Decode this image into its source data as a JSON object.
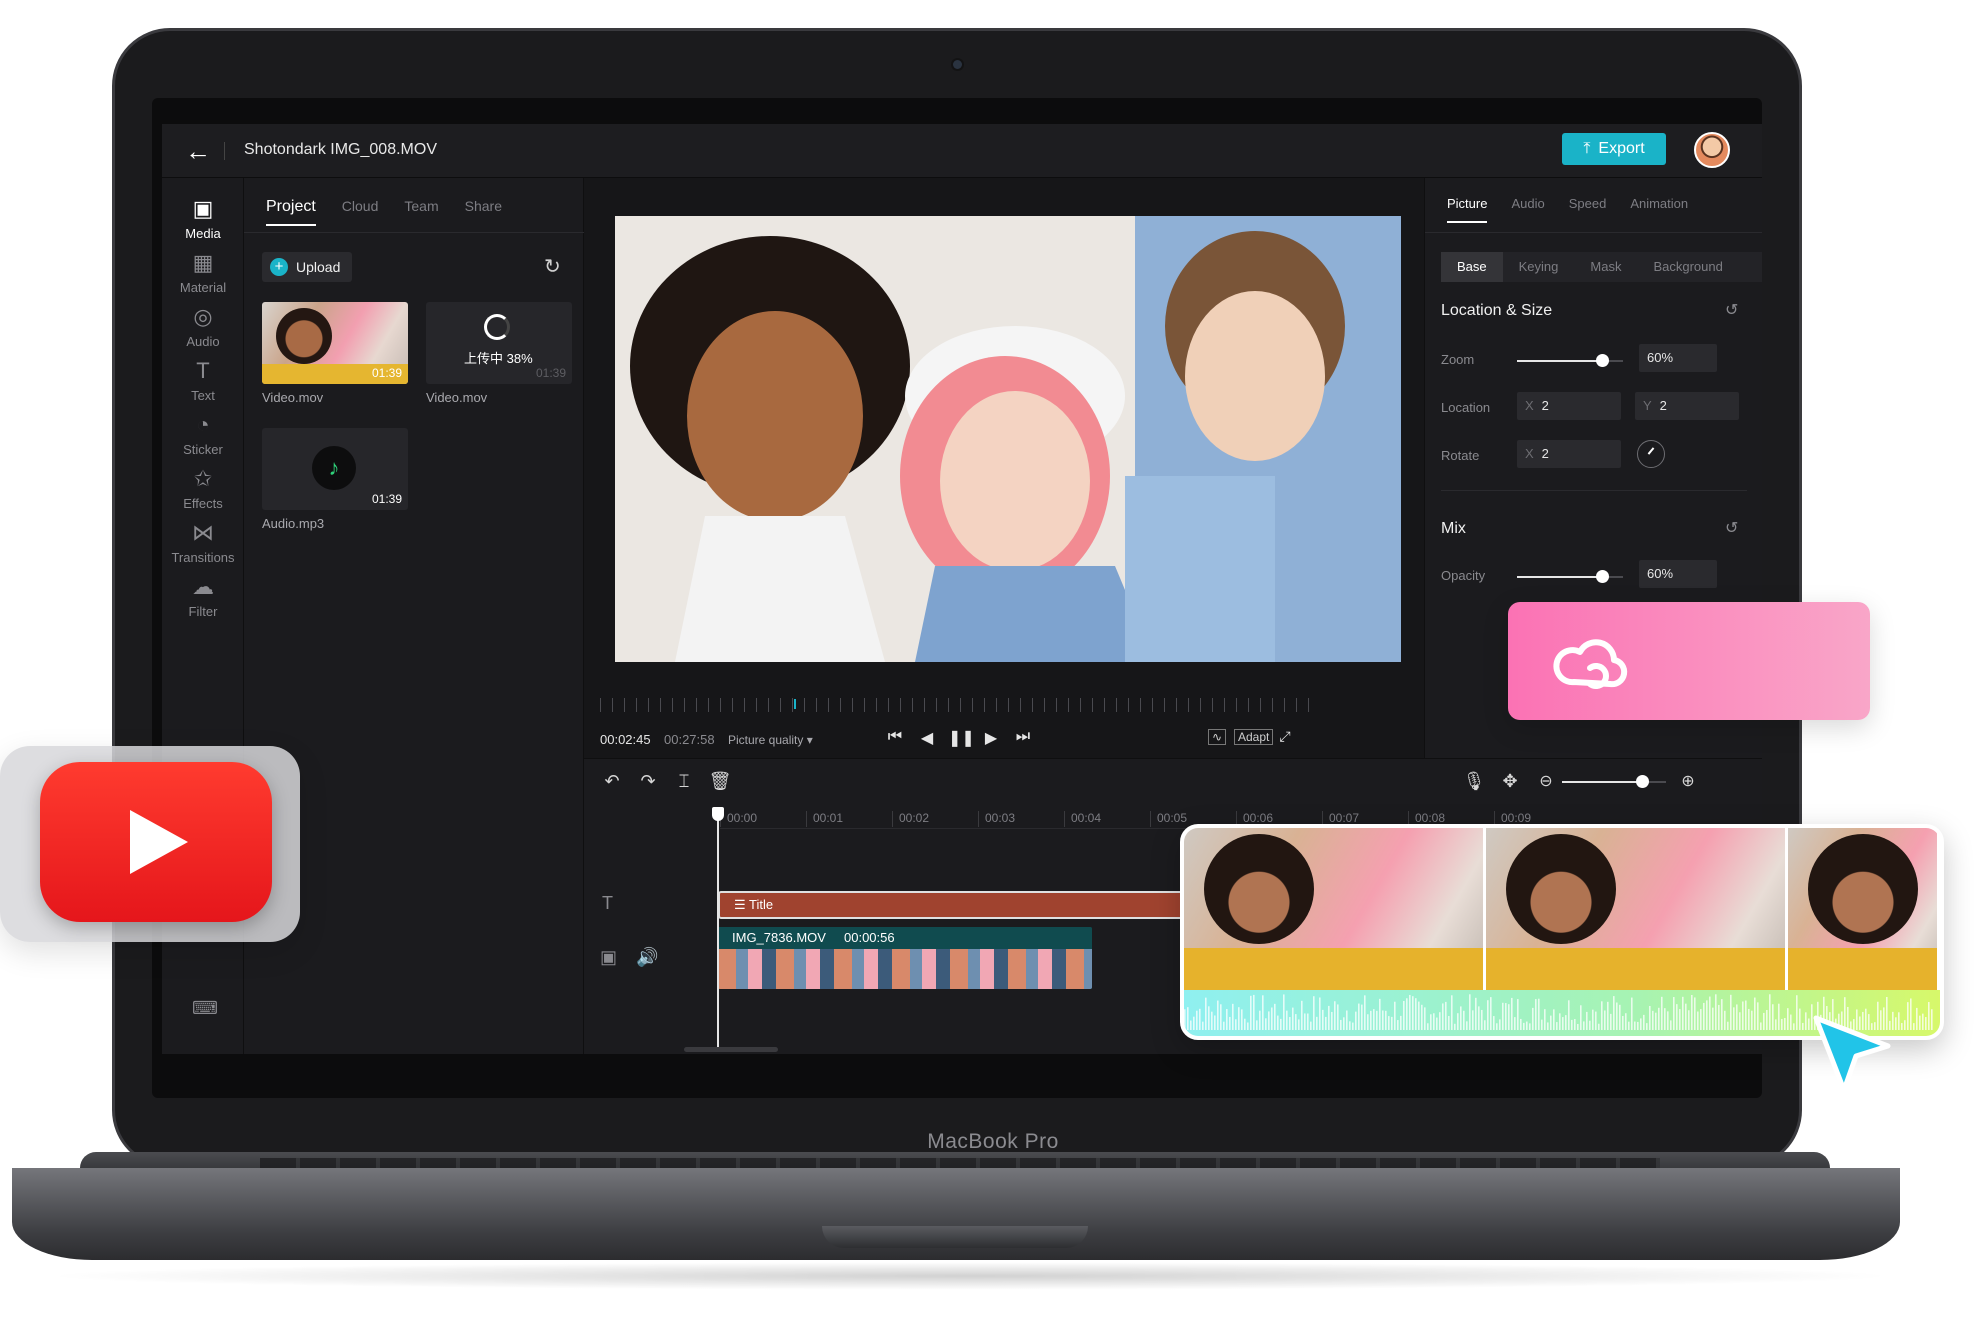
{
  "window": {
    "title": "Shotondark IMG_008.MOV"
  },
  "header": {
    "export_label": "Export"
  },
  "rail": {
    "items": [
      {
        "label": "Media",
        "icon": "media-icon"
      },
      {
        "label": "Material",
        "icon": "material-icon"
      },
      {
        "label": "Audio",
        "icon": "audio-icon"
      },
      {
        "label": "Text",
        "icon": "text-icon"
      },
      {
        "label": "Sticker",
        "icon": "sticker-icon"
      },
      {
        "label": "Effects",
        "icon": "effects-icon"
      },
      {
        "label": "Transitions",
        "icon": "transitions-icon"
      },
      {
        "label": "Filter",
        "icon": "filter-icon"
      }
    ]
  },
  "media": {
    "tabs": [
      "Project",
      "Cloud",
      "Team",
      "Share"
    ],
    "upload_label": "Upload",
    "items": [
      {
        "name": "Video.mov",
        "duration": "01:39"
      },
      {
        "name": "Video.mov",
        "duration": "01:39",
        "status": "上传中 38%",
        "progress": 0.38
      },
      {
        "name": "Audio.mp3",
        "duration": "01:39"
      }
    ]
  },
  "player": {
    "current_time": "00:02:45",
    "total_time": "00:27:58",
    "quality_label": "Picture quality ▾",
    "adapt_label": "Adapt"
  },
  "props": {
    "tabs": [
      "Picture",
      "Audio",
      "Speed",
      "Animation"
    ],
    "subtabs": [
      "Base",
      "Keying",
      "Mask",
      "Background"
    ],
    "location_size_title": "Location & Size",
    "zoom_label": "Zoom",
    "zoom_value": "60%",
    "zoom_fraction": 0.8,
    "location_label": "Location",
    "location_x_axis": "X",
    "location_x": "2",
    "location_y_axis": "Y",
    "location_y": "2",
    "rotate_label": "Rotate",
    "rotate_x_axis": "X",
    "rotate_x": "2",
    "mix_title": "Mix",
    "opacity_label": "Opacity",
    "opacity_value": "60%",
    "opacity_fraction": 0.8
  },
  "timeline": {
    "ruler": [
      "00:00",
      "00:01",
      "00:02",
      "00:03",
      "00:04",
      "00:05",
      "00:06",
      "00:07",
      "00:08",
      "00:09"
    ],
    "title_clip": "Title",
    "video_clip_name": "IMG_7836.MOV",
    "video_clip_duration": "00:00:56"
  },
  "device": {
    "brand": "MacBook Pro"
  },
  "colors": {
    "accent": "#1ab3c8",
    "title_clip": "#a0432f",
    "cloud_card": "#fb72b4",
    "youtube": "#ff3b2f"
  }
}
